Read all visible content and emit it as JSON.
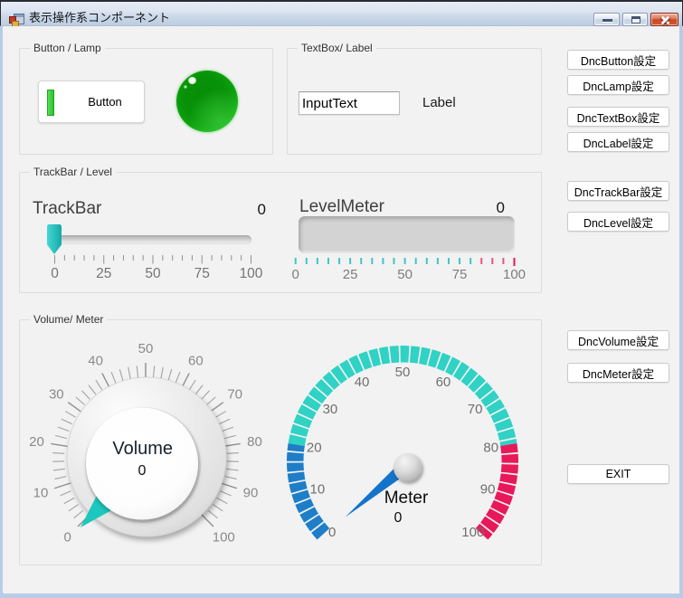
{
  "window": {
    "title": "表示操作系コンポーネント"
  },
  "groups": {
    "button_lamp": {
      "title": "Button / Lamp",
      "button": {
        "label": "Button",
        "indicator_color": "#2cc52c"
      },
      "lamp": {
        "color": "#22c522"
      }
    },
    "textbox_label": {
      "title": "TextBox/ Label",
      "textbox": {
        "value": "InputText"
      },
      "label": {
        "text": "Label"
      }
    },
    "trackbar_level": {
      "title": "TrackBar / Level",
      "trackbar": {
        "title": "TrackBar",
        "value": "0",
        "min": 0,
        "max": 100,
        "minor_step": 5,
        "major_ticks": [
          0,
          25,
          50,
          75,
          100
        ],
        "thumb_color": "#25bdbb"
      },
      "levelmeter": {
        "title": "LevelMeter",
        "value": "0",
        "min": 0,
        "max": 100,
        "minor_step": 5,
        "major_ticks": [
          0,
          25,
          50,
          75,
          100
        ],
        "tick_color_normal": "#3fc6c6",
        "tick_color_high": "#f0527c",
        "tick_color_max": "#e81551",
        "high_threshold": 80
      }
    },
    "volume_meter": {
      "title": "Volume/ Meter",
      "volume": {
        "title": "Volume",
        "value": "0",
        "min": 0,
        "max": 100,
        "minor_step": 2,
        "label_step": 10,
        "labels": [
          0,
          10,
          20,
          30,
          40,
          50,
          60,
          70,
          80,
          90,
          100
        ],
        "pointer_color": "#1cc8bd"
      },
      "meter": {
        "title": "Meter",
        "value": "0",
        "min": 0,
        "max": 100,
        "labels": [
          0,
          10,
          20,
          30,
          40,
          50,
          60,
          70,
          80,
          90,
          100
        ],
        "zones": [
          {
            "from": 0,
            "to": 20,
            "color": "#1e7ec8"
          },
          {
            "from": 20,
            "to": 80,
            "color": "#2fd2c4"
          },
          {
            "from": 80,
            "to": 100,
            "color": "#e9185a"
          }
        ],
        "needle_color": "#1474cc"
      }
    }
  },
  "side_buttons": [
    {
      "label": "DncButton設定"
    },
    {
      "label": "DncLamp設定"
    },
    {
      "label": "DncTextBox設定"
    },
    {
      "label": "DncLabel設定"
    },
    {
      "label": "DncTrackBar設定"
    },
    {
      "label": "DncLevel設定"
    },
    {
      "label": "DncVolume設定"
    },
    {
      "label": "DncMeter設定"
    },
    {
      "label": "EXIT"
    }
  ]
}
